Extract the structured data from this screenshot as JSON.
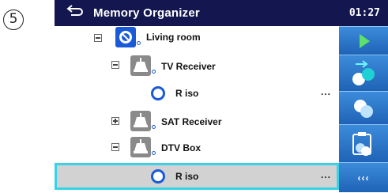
{
  "annotation": {
    "step_number": "5"
  },
  "titlebar": {
    "title": "Memory Organizer",
    "time": "01:27",
    "back_icon": "back-arrow-icon"
  },
  "tree": [
    {
      "label": "Living room",
      "kind": "room-icon",
      "toggle": "collapse"
    },
    {
      "label": "TV Receiver",
      "kind": "appliance-icon",
      "toggle": "collapse"
    },
    {
      "label": "R iso",
      "kind": "measurement-ring-icon",
      "more": "..."
    },
    {
      "label": "SAT Receiver",
      "kind": "appliance-icon",
      "toggle": "expand"
    },
    {
      "label": "DTV Box",
      "kind": "appliance-icon",
      "toggle": "collapse"
    },
    {
      "label": "R iso",
      "kind": "measurement-ring-icon",
      "more": "...",
      "selected": true
    }
  ],
  "sidebar": {
    "buttons": [
      {
        "icon": "play-icon"
      },
      {
        "icon": "add-measurement-icon"
      },
      {
        "icon": "clone-icon"
      },
      {
        "icon": "paste-icon"
      },
      {
        "icon": "more-options-icon",
        "label": "‹‹‹"
      }
    ]
  },
  "colors": {
    "titlebar": "#13164f",
    "sidebar": "#2a72c8",
    "selection_outline": "#39d2e6",
    "accent": "#1a5ad8"
  }
}
